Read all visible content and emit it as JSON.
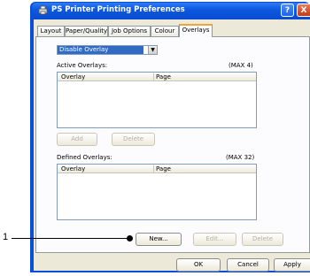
{
  "window": {
    "title": "PS Printer Printing Preferences",
    "help_glyph": "?",
    "close_glyph": "X"
  },
  "tabs": [
    {
      "label": "Layout"
    },
    {
      "label": "Paper/Quality"
    },
    {
      "label": "Job Options"
    },
    {
      "label": "Colour"
    },
    {
      "label": "Overlays",
      "active": true
    }
  ],
  "overlay_mode": {
    "selected": "Disable Overlay",
    "arrow": "▼"
  },
  "active_overlays": {
    "label": "Active Overlays:",
    "max": "(MAX 4)",
    "columns": [
      "Overlay",
      "Page"
    ],
    "add_label": "Add",
    "delete_label": "Delete"
  },
  "defined_overlays": {
    "label": "Defined Overlays:",
    "max": "(MAX 32)",
    "columns": [
      "Overlay",
      "Page"
    ],
    "new_label": "New...",
    "edit_label": "Edit...",
    "delete_label": "Delete"
  },
  "footer": {
    "ok_label": "OK",
    "cancel_label": "Cancel",
    "apply_label": "Apply"
  },
  "callout": {
    "number": "1"
  }
}
